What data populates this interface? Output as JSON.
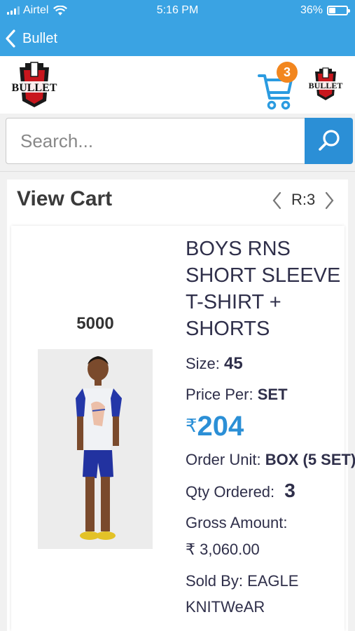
{
  "status_bar": {
    "carrier": "Airtel",
    "time": "5:16 PM",
    "battery_percent": "36%",
    "battery_level": 0.36
  },
  "nav": {
    "back_label": "Bullet",
    "back_icon": "chevron-left-icon"
  },
  "header": {
    "logo_text": "BULLET",
    "cart_count": "3",
    "cart_icon": "shopping-cart-icon"
  },
  "search": {
    "placeholder": "Search...",
    "button_icon": "search-icon"
  },
  "cart": {
    "title": "View Cart",
    "pager_label": "R:3"
  },
  "item": {
    "code": "5000",
    "name": "BOYS RNS SHORT SLEEVE T-SHIRT + SHORTS",
    "size_label": "Size:",
    "size_value": "45",
    "price_per_label": "Price Per:",
    "price_per_value": "SET",
    "currency_symbol": "₹",
    "price": "204",
    "order_unit_label": "Order Unit:",
    "order_unit_value": "BOX (5 SET)",
    "qty_label": "Qty Ordered:",
    "qty_value": "3",
    "gross_label": "Gross Amount:",
    "gross_value": "₹ 3,060.00",
    "sold_by_label": "Sold By:",
    "sold_by_line1": "EAGLE",
    "sold_by_line2": "KNITWeAR"
  },
  "colors": {
    "primary": "#3aa3e3",
    "search_button": "#2b8fd6",
    "badge": "#f2861e",
    "price": "#2b8fd6"
  }
}
